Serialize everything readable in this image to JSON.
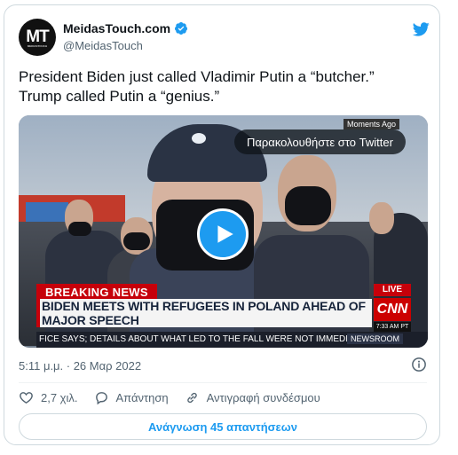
{
  "author": {
    "avatar_text": "MT",
    "avatar_subtext": "MEIDASTOUCH",
    "display_name": "MeidasTouch.com",
    "handle": "@MeidasTouch",
    "verified_icon": "verified-badge-icon"
  },
  "brand": {
    "icon": "twitter-bird-icon",
    "color": "#1d9bf0"
  },
  "tweet": {
    "text_line1": "President Biden just called Vladimir Putin a “butcher.”",
    "text_line2": "Trump called Putin a “genius.”",
    "timestamp": "5:11 μ.μ. · 26 Μαρ 2022"
  },
  "media": {
    "watch_label": "Παρακολουθήστε στο Twitter",
    "moments_tag": "Moments Ago",
    "breaking_label": "BREAKING NEWS",
    "headline": "BIDEN MEETS WITH REFUGEES IN POLAND AHEAD OF MAJOR SPEECH",
    "live_label": "LIVE",
    "network": "CNN",
    "broadcast_time": "7:33 AM PT",
    "ticker": "FICE SAYS; DETAILS ABOUT WHAT LED TO THE FALL WERE NOT IMMEDIATELY",
    "show_name": "NEWSROOM",
    "play_icon": "play-icon"
  },
  "actions": {
    "likes": "2,7 χιλ.",
    "reply_label": "Απάντηση",
    "copy_link_label": "Αντιγραφή συνδέσμου"
  },
  "read_replies_label": "Ανάγνωση 45 απαντήσεων"
}
